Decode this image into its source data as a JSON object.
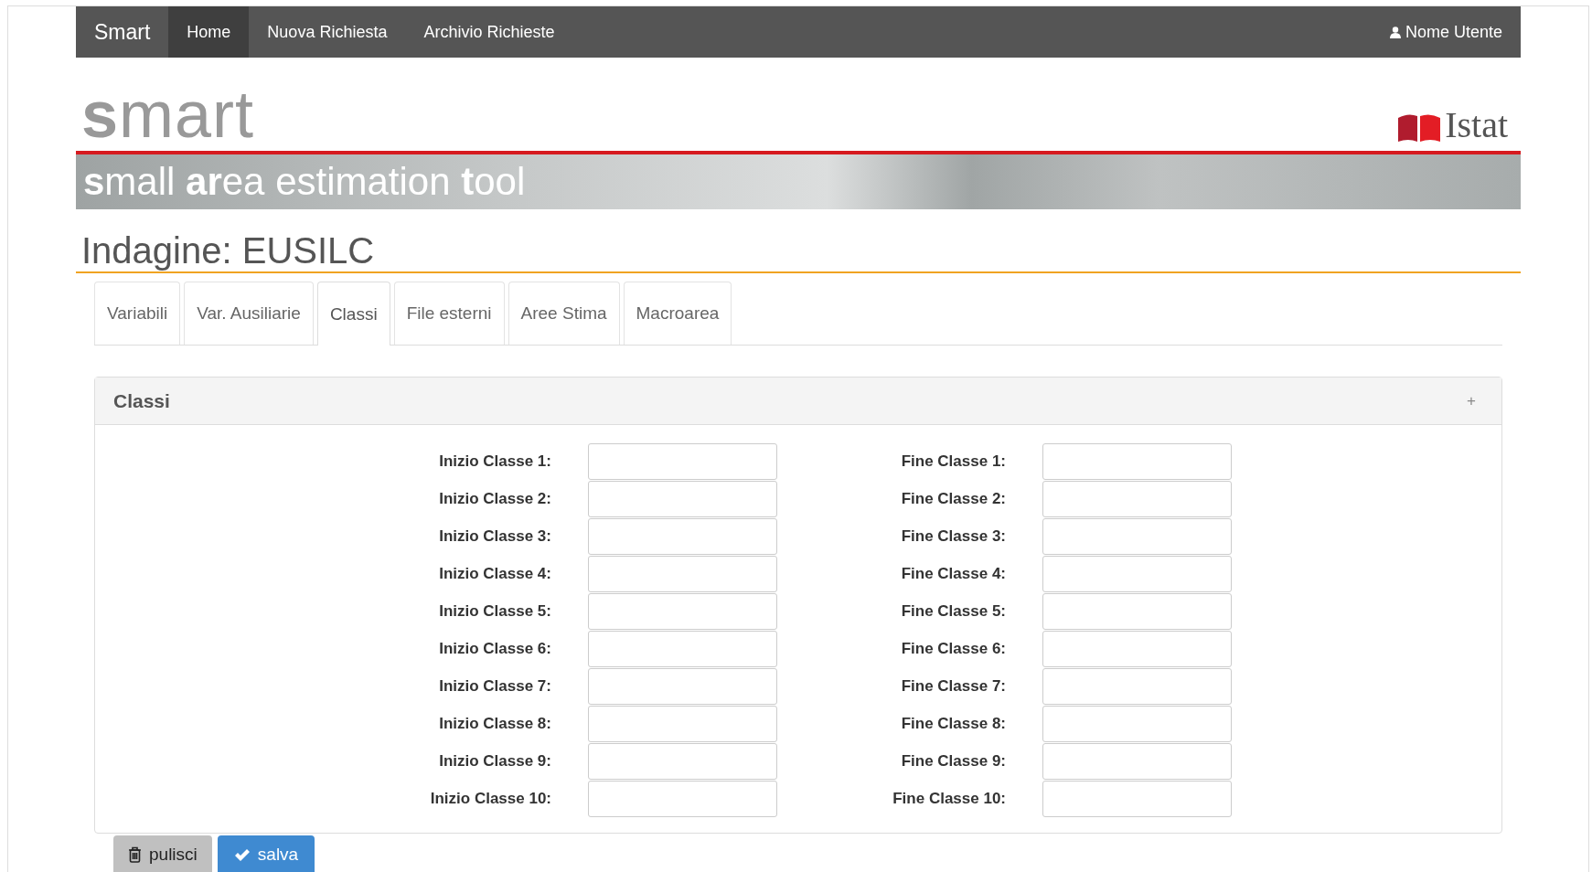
{
  "navbar": {
    "brand": "Smart",
    "items": [
      {
        "label": "Home",
        "selected": true
      },
      {
        "label": "Nuova Richiesta",
        "selected": false
      },
      {
        "label": "Archivio Richieste",
        "selected": false
      }
    ],
    "user": "Nome Utente"
  },
  "header": {
    "logo": "**s**mart",
    "tagline": "**s**mall **ar**ea estimation **t**ool",
    "org_logo": "Istat"
  },
  "title": "Indagine: EUSILC",
  "tabs": [
    {
      "label": "Variabili",
      "selected": false
    },
    {
      "label": "Var. Ausiliarie",
      "selected": false
    },
    {
      "label": "Classi",
      "selected": true
    },
    {
      "label": "File esterni",
      "selected": false
    },
    {
      "label": "Aree Stima",
      "selected": false
    },
    {
      "label": "Macroarea",
      "selected": false
    }
  ],
  "panel": {
    "title": "Classi",
    "toggle": "+",
    "rows": [
      {
        "start_label": "Inizio Classe 1:",
        "end_label": "Fine Classe 1:"
      },
      {
        "start_label": "Inizio Classe 2:",
        "end_label": "Fine Classe 2:"
      },
      {
        "start_label": "Inizio Classe 3:",
        "end_label": "Fine Classe 3:"
      },
      {
        "start_label": "Inizio Classe 4:",
        "end_label": "Fine Classe 4:"
      },
      {
        "start_label": "Inizio Classe 5:",
        "end_label": "Fine Classe 5:"
      },
      {
        "start_label": "Inizio Classe 6:",
        "end_label": "Fine Classe 6:"
      },
      {
        "start_label": "Inizio Classe 7:",
        "end_label": "Fine Classe 7:"
      },
      {
        "start_label": "Inizio Classe 8:",
        "end_label": "Fine Classe 8:"
      },
      {
        "start_label": "Inizio Classe 9:",
        "end_label": "Fine Classe 9:"
      },
      {
        "start_label": "Inizio Classe 10:",
        "end_label": "Fine Classe 10:"
      }
    ]
  },
  "buttons": [
    {
      "kind": "clear",
      "label": "pulisci"
    },
    {
      "kind": "save",
      "label": "salva"
    }
  ]
}
